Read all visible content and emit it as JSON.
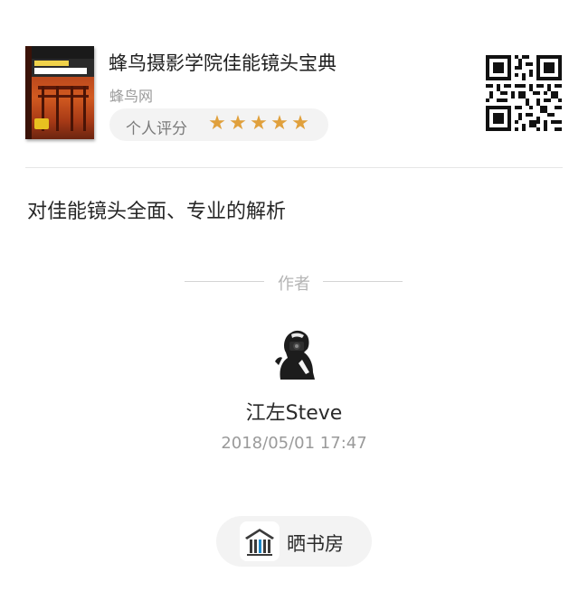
{
  "book": {
    "title": "蜂鸟摄影学院佳能镜头宝典",
    "source": "蜂鸟网",
    "rating_label": "个人评分",
    "rating": 5,
    "rating_max": 5,
    "star_color": "#e0a03c"
  },
  "review": {
    "text": "对佳能镜头全面、专业的解析"
  },
  "author": {
    "heading": "作者",
    "name": "江左Steve",
    "date": "2018/05/01  17:47"
  },
  "share": {
    "label": "晒书房",
    "icon": "bookshelf-icon"
  }
}
